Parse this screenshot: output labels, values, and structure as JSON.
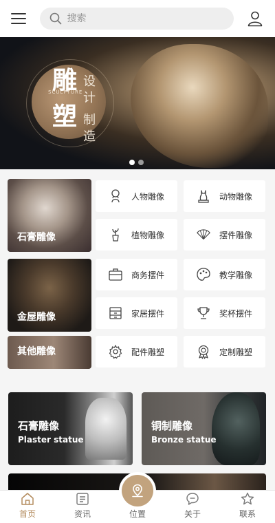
{
  "header": {
    "menu_icon": "hamburger-icon",
    "search": {
      "placeholder": "搜索",
      "value": ""
    },
    "user_icon": "user-icon"
  },
  "banner": {
    "char_1": "雕",
    "char_2": "塑",
    "subtitle_1": "设",
    "subtitle_2": "计",
    "subtitle_3": "制",
    "subtitle_4": "造",
    "en": "SCULPTURE",
    "dots": 2,
    "active_dot": 0
  },
  "categories": {
    "big": [
      {
        "label": "石膏雕像"
      },
      {
        "label": "金屋雕像"
      },
      {
        "label": "其他雕像"
      }
    ],
    "small": [
      {
        "label": "人物雕像",
        "icon": "bust-icon"
      },
      {
        "label": "动物雕像",
        "icon": "cat-statue-icon"
      },
      {
        "label": "植物雕像",
        "icon": "plant-icon"
      },
      {
        "label": "摆件雕像",
        "icon": "fan-icon"
      },
      {
        "label": "商务摆件",
        "icon": "briefcase-icon"
      },
      {
        "label": "教学雕像",
        "icon": "palette-icon"
      },
      {
        "label": "家居摆件",
        "icon": "cabinet-icon"
      },
      {
        "label": "奖杯摆件",
        "icon": "trophy-icon"
      },
      {
        "label": "配件雕塑",
        "icon": "gear-icon"
      },
      {
        "label": "定制雕塑",
        "icon": "badge-icon"
      }
    ]
  },
  "features": [
    {
      "title": "石膏雕像",
      "subtitle": "Plaster statue"
    },
    {
      "title": "铜制雕像",
      "subtitle": "Bronze statue"
    }
  ],
  "bottom_nav": {
    "items": [
      {
        "label": "首页",
        "icon": "home-icon",
        "active": true
      },
      {
        "label": "资讯",
        "icon": "news-icon",
        "active": false
      },
      {
        "label": "位置",
        "icon": "location-icon",
        "active": false
      },
      {
        "label": "关于",
        "icon": "chat-icon",
        "active": false
      },
      {
        "label": "联系",
        "icon": "star-icon",
        "active": false
      }
    ]
  },
  "colors": {
    "accent": "#b38b5d",
    "location_button": "#c2a37e"
  }
}
